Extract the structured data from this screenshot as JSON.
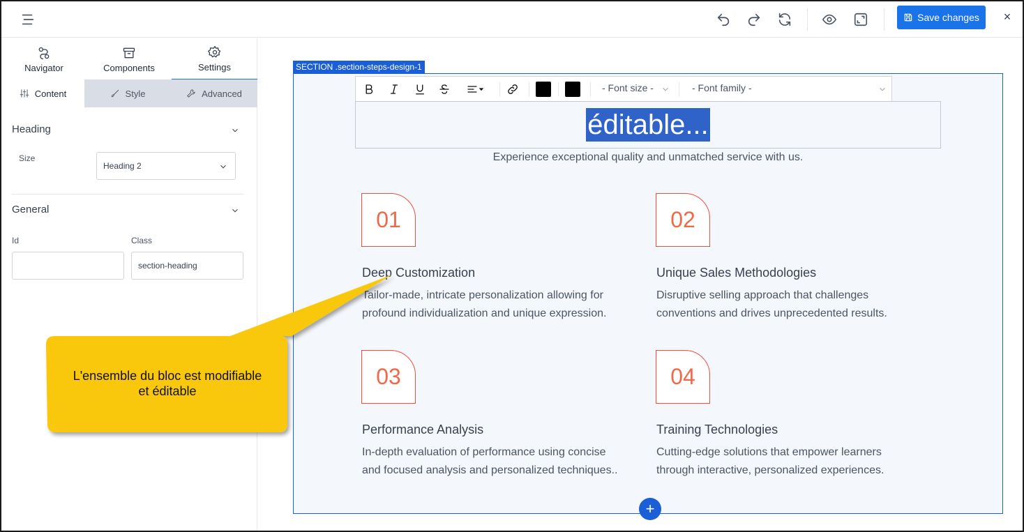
{
  "toolbar": {
    "save_label": "Save changes",
    "close_label": "×"
  },
  "panel_tabs": [
    {
      "label": "Navigator",
      "icon": "navigator-icon"
    },
    {
      "label": "Components",
      "icon": "archive-icon"
    },
    {
      "label": "Settings",
      "icon": "gear-icon"
    }
  ],
  "sub_tabs": [
    {
      "label": "Content",
      "icon": "sliders-icon"
    },
    {
      "label": "Style",
      "icon": "brush-icon"
    },
    {
      "label": "Advanced",
      "icon": "wrench-icon"
    }
  ],
  "heading_section": {
    "title": "Heading",
    "size_label": "Size",
    "size_value": "Heading 2"
  },
  "general_section": {
    "title": "General",
    "id_label": "Id",
    "id_value": "",
    "class_label": "Class",
    "class_value": "section-heading"
  },
  "canvas": {
    "section_tag": "SECTION .section-steps-design-1",
    "rte": {
      "font_size_placeholder": "- Font size -",
      "font_family_placeholder": "- Font family -",
      "color_1": "#000000",
      "color_2": "#000000"
    },
    "heading_text": "éditable...",
    "subtitle": "Experience exceptional quality and unmatched service with us.",
    "steps": [
      {
        "number": "01",
        "title": "Deep Customization",
        "desc_1": "Tailor-made, intricate personalization allowing for",
        "desc_2": "profound individualization and unique expression."
      },
      {
        "number": "02",
        "title": "Unique Sales Methodologies",
        "desc_1": "Disruptive selling approach that challenges",
        "desc_2": "conventions and drives unprecedented results."
      },
      {
        "number": "03",
        "title": "Performance Analysis",
        "desc_1": "In-depth evaluation of performance using concise",
        "desc_2": "and focused analysis and personalized techniques.."
      },
      {
        "number": "04",
        "title": "Training Technologies",
        "desc_1": "Cutting-edge solutions that empower learners",
        "desc_2": "through interactive, personalized experiences."
      }
    ],
    "add_label": "+"
  },
  "callout": {
    "line_1": "L'ensemble du bloc est modifiable",
    "line_2": "et éditable",
    "color": "#f9c80e"
  },
  "colors": {
    "accent": "#1a73e8",
    "section_outline": "#1a5fd6",
    "step_accent": "#ef4f3a"
  }
}
